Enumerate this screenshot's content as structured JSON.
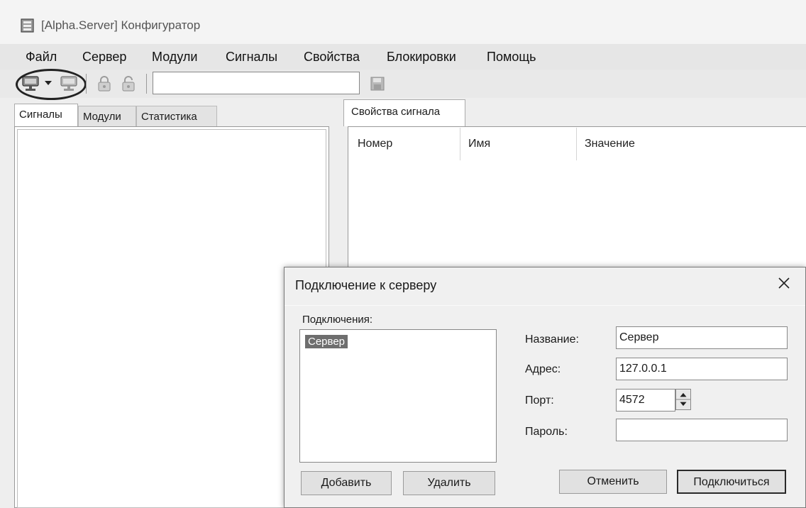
{
  "window": {
    "title": "[Alpha.Server] Конфигуратор",
    "app_icon": "server-window-icon"
  },
  "menu": {
    "items": [
      "Файл",
      "Сервер",
      "Модули",
      "Сигналы",
      "Свойства",
      "Блокировки",
      "Помощь"
    ]
  },
  "toolbar": {
    "icons": [
      "connect-server-icon",
      "chevron-down-icon",
      "disconnect-server-icon",
      "lock-icon",
      "unlock-icon",
      "save-icon"
    ],
    "search_value": ""
  },
  "left_tabs": [
    "Сигналы",
    "Модули",
    "Статистика"
  ],
  "right_panel": {
    "tab": "Свойства сигнала",
    "columns": [
      "Номер",
      "Имя",
      "Значение"
    ]
  },
  "dialog": {
    "title": "Подключение к серверу",
    "connections_label": "Подключения:",
    "connections": [
      "Сервер"
    ],
    "fields": {
      "name_label": "Название:",
      "name_value": "Сервер",
      "address_label": "Адрес:",
      "address_value": "127.0.0.1",
      "port_label": "Порт:",
      "port_value": "4572",
      "password_label": "Пароль:",
      "password_value": ""
    },
    "buttons": {
      "add": "Добавить",
      "delete": "Удалить",
      "cancel": "Отменить",
      "connect": "Подключиться"
    }
  }
}
